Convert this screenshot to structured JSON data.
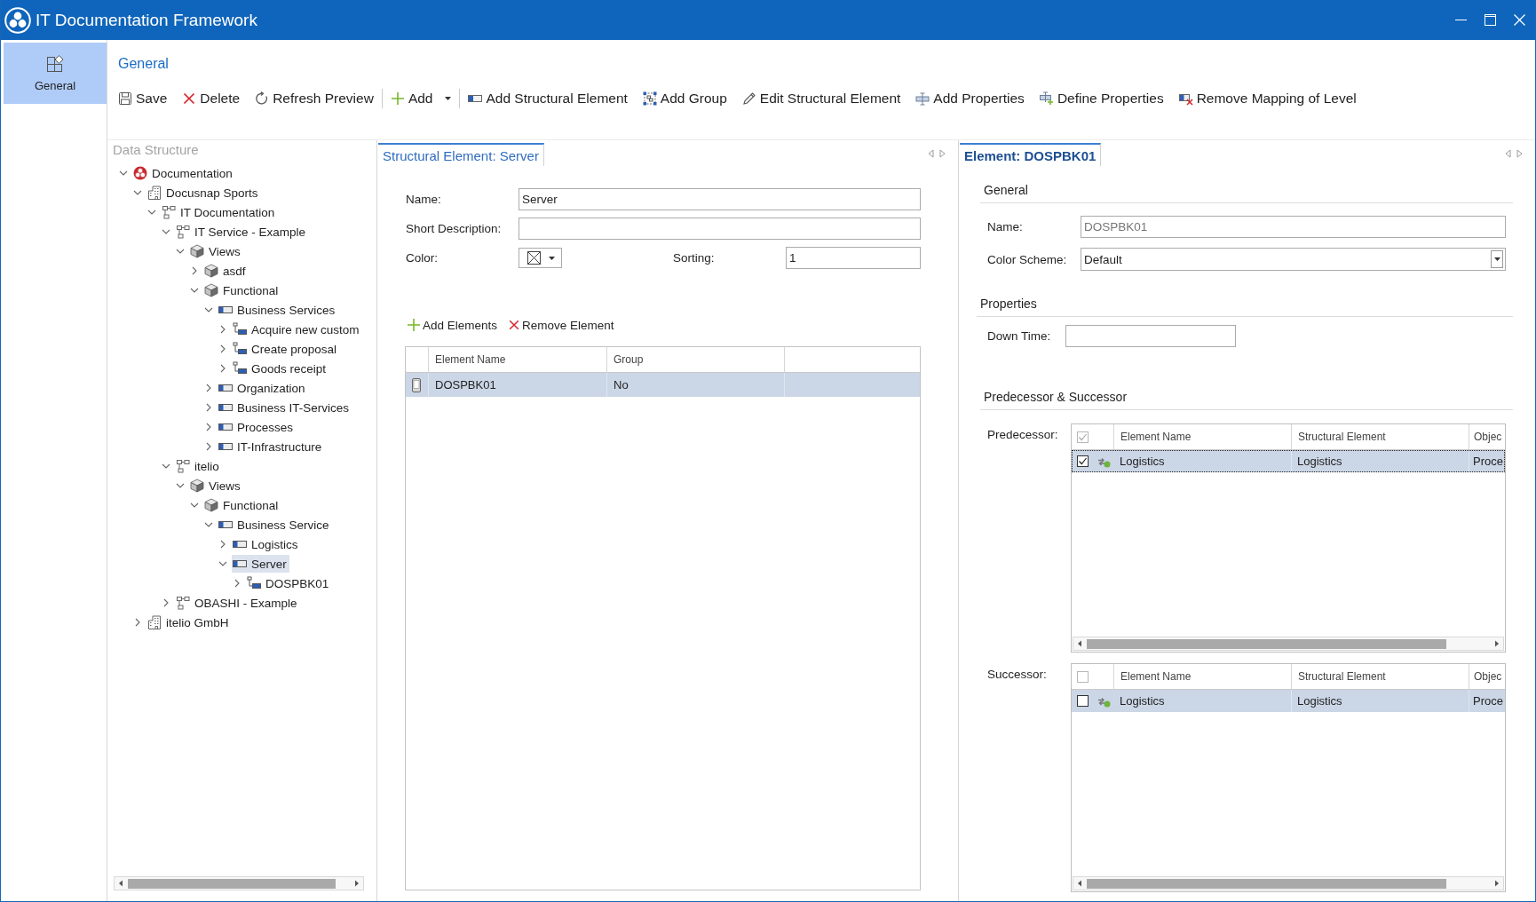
{
  "window": {
    "title": "IT Documentation Framework"
  },
  "nav": [
    {
      "label": "General",
      "selected": true
    }
  ],
  "ribbon": {
    "title": "General",
    "groups": [
      [
        {
          "label": "Save",
          "dropdown": false
        },
        {
          "label": "Delete",
          "dropdown": false
        },
        {
          "label": "Refresh Preview",
          "dropdown": false
        }
      ],
      [
        {
          "label": "Add",
          "dropdown": true
        }
      ],
      [
        {
          "label": "Add Structural Element",
          "dropdown": false
        },
        {
          "label": "Add Group",
          "dropdown": false
        },
        {
          "label": "Edit Structural Element",
          "dropdown": false
        },
        {
          "label": "Add Properties",
          "dropdown": false
        },
        {
          "label": "Define Properties",
          "dropdown": false
        },
        {
          "label": "Remove Mapping of Level",
          "dropdown": false
        }
      ]
    ]
  },
  "data_structure": {
    "title": "Data Structure",
    "tree": [
      {
        "label": "Documentation",
        "kind": "root",
        "expanded": true,
        "selected": false,
        "children": [
          {
            "label": "Docusnap Sports",
            "kind": "company",
            "expanded": true,
            "selected": false,
            "children": [
              {
                "label": "IT Documentation",
                "kind": "hierarchy",
                "expanded": true,
                "selected": false,
                "children": [
                  {
                    "label": "IT Service - Example",
                    "kind": "hierarchy",
                    "expanded": true,
                    "selected": false,
                    "children": [
                      {
                        "label": "Views",
                        "kind": "view",
                        "expanded": true,
                        "selected": false,
                        "children": [
                          {
                            "label": "asdf",
                            "kind": "view",
                            "expanded": false,
                            "selected": false
                          },
                          {
                            "label": "Functional",
                            "kind": "view",
                            "expanded": true,
                            "selected": false,
                            "children": [
                              {
                                "label": "Business Services",
                                "kind": "structure",
                                "expanded": true,
                                "selected": false,
                                "children": [
                                  {
                                    "label": "Acquire new custom",
                                    "kind": "element",
                                    "expanded": false,
                                    "selected": false
                                  },
                                  {
                                    "label": "Create proposal",
                                    "kind": "element",
                                    "expanded": false,
                                    "selected": false
                                  },
                                  {
                                    "label": "Goods receipt",
                                    "kind": "element",
                                    "expanded": false,
                                    "selected": false
                                  }
                                ]
                              },
                              {
                                "label": "Organization",
                                "kind": "structure",
                                "expanded": false,
                                "selected": false
                              },
                              {
                                "label": "Business IT-Services",
                                "kind": "structure",
                                "expanded": false,
                                "selected": false
                              },
                              {
                                "label": "Processes",
                                "kind": "structure",
                                "expanded": false,
                                "selected": false
                              },
                              {
                                "label": "IT-Infrastructure",
                                "kind": "structure",
                                "expanded": false,
                                "selected": false
                              }
                            ]
                          }
                        ]
                      }
                    ]
                  },
                  {
                    "label": "itelio",
                    "kind": "hierarchy",
                    "expanded": true,
                    "selected": false,
                    "children": [
                      {
                        "label": "Views",
                        "kind": "view",
                        "expanded": true,
                        "selected": false,
                        "children": [
                          {
                            "label": "Functional",
                            "kind": "view",
                            "expanded": true,
                            "selected": false,
                            "children": [
                              {
                                "label": "Business Service",
                                "kind": "structure",
                                "expanded": true,
                                "selected": false,
                                "children": [
                                  {
                                    "label": "Logistics",
                                    "kind": "structure",
                                    "expanded": false,
                                    "selected": false
                                  },
                                  {
                                    "label": "Server",
                                    "kind": "structure",
                                    "expanded": true,
                                    "selected": true,
                                    "children": [
                                      {
                                        "label": "DOSPBK01",
                                        "kind": "element",
                                        "expanded": false,
                                        "selected": false
                                      }
                                    ]
                                  }
                                ]
                              }
                            ]
                          }
                        ]
                      }
                    ]
                  },
                  {
                    "label": "OBASHI - Example",
                    "kind": "hierarchy",
                    "expanded": false,
                    "selected": false
                  }
                ]
              }
            ]
          },
          {
            "label": "itelio GmbH",
            "kind": "company",
            "expanded": false,
            "selected": false
          }
        ]
      }
    ]
  },
  "structural_element": {
    "tab": {
      "label": "Structural Element: Server",
      "selected": true,
      "focused": false
    },
    "fields": {
      "name": {
        "label": "Name:",
        "value": "Server"
      },
      "short_description": {
        "label": "Short Description:"
      },
      "color": {
        "label": "Color:"
      },
      "sorting": {
        "label": "Sorting:",
        "value": "1"
      }
    },
    "actions": [
      {
        "label": "Add Elements"
      },
      {
        "label": "Remove Element"
      }
    ],
    "table": {
      "columns": [
        "Element Name",
        "Group"
      ],
      "rows": [
        {
          "cells": [
            "DOSPBK01",
            "No"
          ],
          "selected": true
        }
      ]
    }
  },
  "element": {
    "tab": {
      "label": "Element: DOSPBK01",
      "selected": true,
      "focused": true
    },
    "general": {
      "title": "General",
      "name": {
        "label": "Name:",
        "value": "DOSPBK01",
        "disabled": true
      },
      "color_scheme": {
        "label": "Color Scheme:",
        "value": "Default"
      }
    },
    "properties": {
      "title": "Properties",
      "fields": [
        {
          "label": "Down Time:"
        }
      ]
    },
    "relations": {
      "title": "Predecessor & Successor",
      "tables": [
        {
          "label": "Predecessor:",
          "all_checked": true,
          "columns": [
            "Element Name",
            "Structural Element",
            "Objec"
          ],
          "rows": [
            {
              "cells": [
                "Logistics",
                "Logistics",
                "Proce"
              ],
              "checked": true,
              "selected": true,
              "focused": true
            }
          ]
        },
        {
          "label": "Successor:",
          "all_checked": false,
          "columns": [
            "Element Name",
            "Structural Element",
            "Objec"
          ],
          "rows": [
            {
              "cells": [
                "Logistics",
                "Logistics",
                "Proce"
              ],
              "checked": false,
              "selected": true,
              "focused": false
            }
          ]
        }
      ]
    }
  }
}
